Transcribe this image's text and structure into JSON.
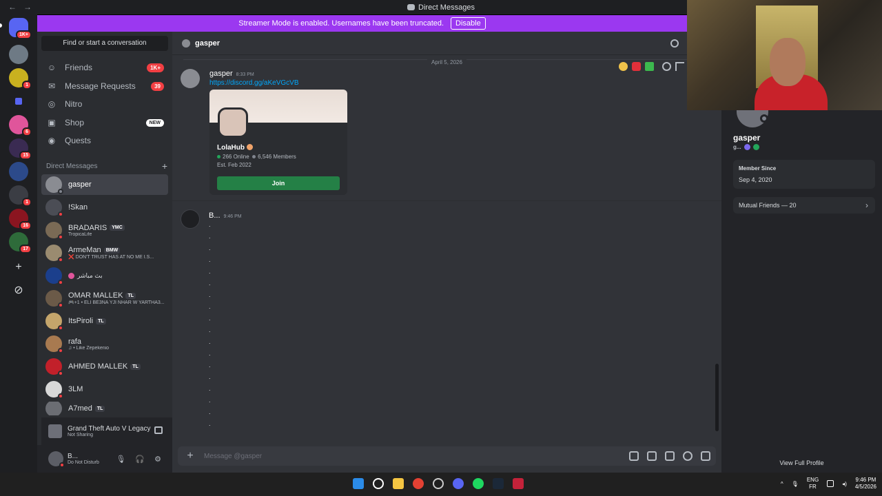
{
  "window": {
    "title": "Direct Messages",
    "back": "←",
    "forward": "→"
  },
  "banner": {
    "text": "Streamer Mode is enabled. Usernames have been truncated.",
    "button": "Disable"
  },
  "rail": {
    "home_badge": "1K+",
    "servers": [
      {
        "badge": ""
      },
      {
        "badge": "1"
      },
      {
        "badge": ""
      },
      {
        "badge": "6"
      },
      {
        "badge": "15"
      },
      {
        "badge": ""
      },
      {
        "badge": "1"
      },
      {
        "badge": "16"
      },
      {
        "badge": "17"
      }
    ],
    "add": "+",
    "discover": "⊘"
  },
  "sidebar": {
    "find": "Find or start a conversation",
    "nav": [
      {
        "label": "Friends",
        "count": "1K+",
        "icon": "friends-icon"
      },
      {
        "label": "Message Requests",
        "count": "39",
        "icon": "mail-icon"
      },
      {
        "label": "Nitro",
        "count": "",
        "icon": "nitro-icon"
      },
      {
        "label": "Shop",
        "new": "NEW",
        "icon": "shop-icon"
      },
      {
        "label": "Quests",
        "count": "",
        "icon": "quests-icon"
      }
    ],
    "dm_header": "Direct Messages",
    "dm_add": "+",
    "dms": [
      {
        "name": "gasper",
        "tag": "",
        "sub": ""
      },
      {
        "name": "!Skan",
        "tag": "",
        "sub": ""
      },
      {
        "name": "BRADARIS",
        "tag": "YMC",
        "sub": "TropicaLife"
      },
      {
        "name": "ArmeMan",
        "tag": "BMW",
        "sub": "❌ DON'T TRUST HAS AT NO ME I.S..."
      },
      {
        "name": "بث مباشر",
        "tag": "",
        "sub": ""
      },
      {
        "name": "OMAR MALLEK",
        "tag": "TL",
        "sub": "🎮+1 • ELI BE3NA YJI NHAR W YARTHA3..."
      },
      {
        "name": "ItsPiroli",
        "tag": "TL",
        "sub": ""
      },
      {
        "name": "rafa",
        "tag": "",
        "sub": "♫ • Like Zepekenio"
      },
      {
        "name": "AHMED MALLEK",
        "tag": "TL",
        "sub": ""
      },
      {
        "name": "3LM",
        "tag": "",
        "sub": ""
      },
      {
        "name": "A7med",
        "tag": "TL",
        "sub": ""
      }
    ],
    "activity": {
      "game": "Grand Theft Auto V Legacy",
      "status": "Not Sharing"
    },
    "user": {
      "name": "B...",
      "status": "Do Not Disturb"
    }
  },
  "chat": {
    "header_name": "gasper",
    "date": "April 5, 2026",
    "messages": [
      {
        "author": "gasper",
        "time": "8:33 PM",
        "link": "https://discord.gg/aKeVGcVB"
      },
      {
        "author": "B...",
        "time": "9:46 PM"
      }
    ],
    "invite": {
      "name": "LolaHub",
      "online": "266 Online",
      "members": "6,546 Members",
      "est": "Est. Feb 2022",
      "join": "Join"
    },
    "dots": [
      ".",
      ".",
      ".",
      ".",
      ".",
      ".",
      ".",
      ".",
      ".",
      ".",
      ".",
      ".",
      ".",
      ".",
      ".",
      ".",
      ".",
      "."
    ],
    "composer_placeholder": "Message @gasper"
  },
  "profile": {
    "name": "gasper",
    "sub": "g...",
    "member_since_label": "Member Since",
    "member_since": "Sep 4, 2020",
    "mutual_friends": "Mutual Friends — 20",
    "view_full": "View Full Profile"
  },
  "taskbar": {
    "lang1": "ENG",
    "lang2": "FR",
    "time": "9:46 PM",
    "date": "4/5/2026"
  },
  "colors": {
    "brand": "#9b38f0",
    "join": "#248046",
    "badge": "#f23f43",
    "link": "#00a8fc"
  }
}
